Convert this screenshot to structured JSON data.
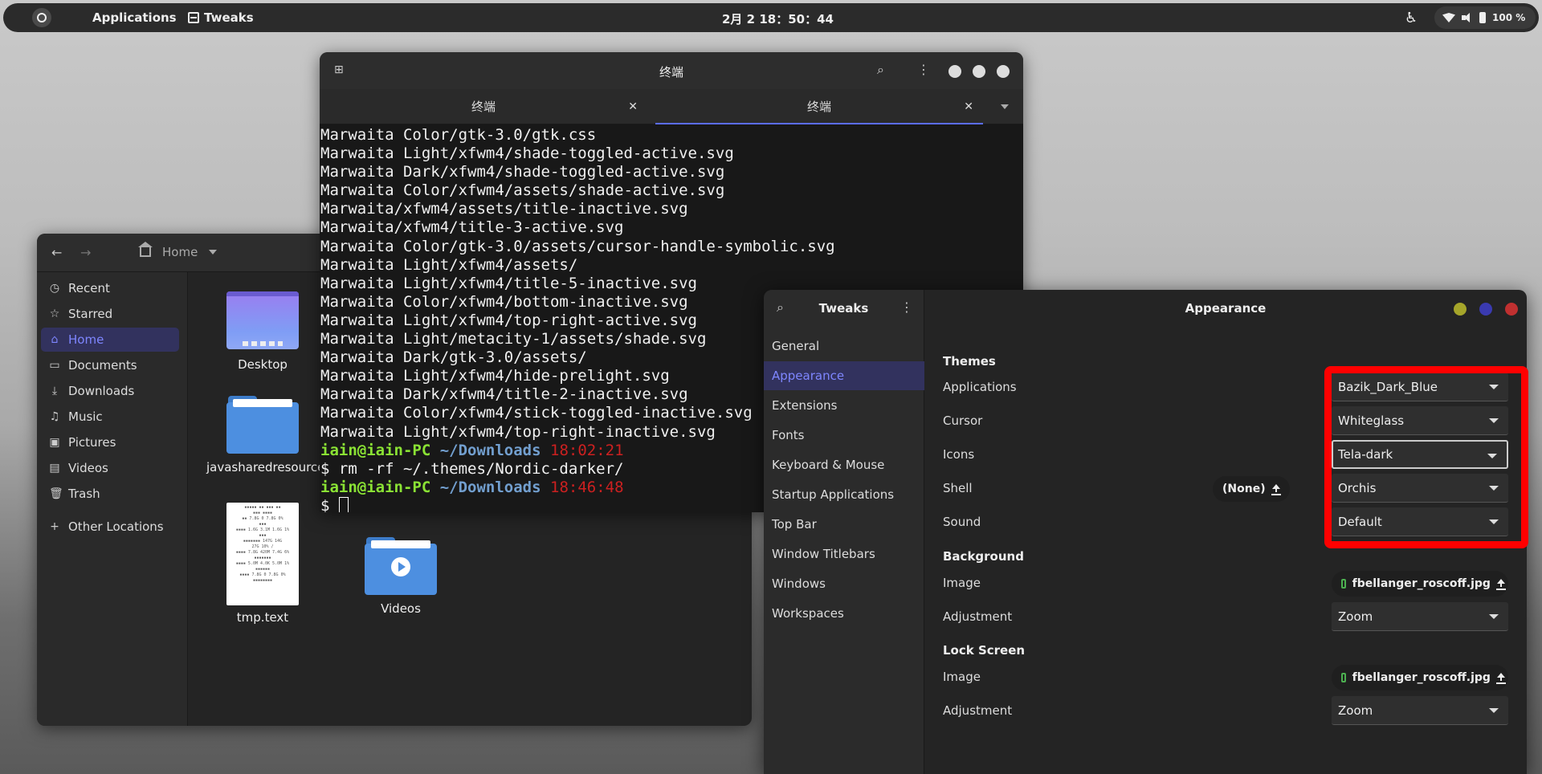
{
  "topbar": {
    "applications": "Applications",
    "active_app": "Tweaks",
    "clock": "2月 2  18：50：44",
    "battery": "100 %"
  },
  "files": {
    "path": "Home",
    "sidebar": [
      {
        "label": "Recent",
        "icon": "clock-icon"
      },
      {
        "label": "Starred",
        "icon": "star-icon"
      },
      {
        "label": "Home",
        "icon": "home-icon",
        "active": true
      },
      {
        "label": "Documents",
        "icon": "document-icon"
      },
      {
        "label": "Downloads",
        "icon": "download-icon"
      },
      {
        "label": "Music",
        "icon": "music-icon"
      },
      {
        "label": "Pictures",
        "icon": "picture-icon"
      },
      {
        "label": "Videos",
        "icon": "video-icon"
      },
      {
        "label": "Trash",
        "icon": "trash-icon"
      },
      {
        "label": "Other Locations",
        "icon": "plus-icon"
      }
    ],
    "items": [
      "Desktop",
      "javasharedresources",
      "tmp.text",
      "Videos"
    ]
  },
  "terminal": {
    "title": "终端",
    "tabs": [
      "终端",
      "终端"
    ],
    "lines": [
      "Marwaita Color/gtk-3.0/gtk.css",
      "Marwaita Light/xfwm4/shade-toggled-active.svg",
      "Marwaita Dark/xfwm4/shade-toggled-active.svg",
      "Marwaita Color/xfwm4/assets/shade-active.svg",
      "Marwaita/xfwm4/assets/title-inactive.svg",
      "Marwaita/xfwm4/title-3-active.svg",
      "Marwaita Color/gtk-3.0/assets/cursor-handle-symbolic.svg",
      "Marwaita Light/xfwm4/assets/",
      "Marwaita Light/xfwm4/title-5-inactive.svg",
      "Marwaita Color/xfwm4/bottom-inactive.svg",
      "Marwaita Light/xfwm4/top-right-active.svg",
      "Marwaita Light/metacity-1/assets/shade.svg",
      "Marwaita Dark/gtk-3.0/assets/",
      "Marwaita Light/xfwm4/hide-prelight.svg",
      "Marwaita Dark/xfwm4/title-2-inactive.svg",
      "Marwaita Color/xfwm4/stick-toggled-inactive.svg",
      "Marwaita Light/xfwm4/top-right-inactive.svg"
    ],
    "prompt1": {
      "user": "iain@iain-PC",
      "dir": "~/Downloads",
      "time": "18:02:21"
    },
    "command1": "$ rm -rf ~/.themes/Nordic-darker/",
    "prompt2": {
      "user": "iain@iain-PC",
      "dir": "~/Downloads",
      "time": "18:46:48"
    },
    "prompt_symbol": "$ "
  },
  "tweaks": {
    "title": "Tweaks",
    "page_title": "Appearance",
    "sidebar": [
      "General",
      "Appearance",
      "Extensions",
      "Fonts",
      "Keyboard & Mouse",
      "Startup Applications",
      "Top Bar",
      "Window Titlebars",
      "Windows",
      "Workspaces"
    ],
    "themes_header": "Themes",
    "applications_label": "Applications",
    "applications_value": "Bazik_Dark_Blue",
    "cursor_label": "Cursor",
    "cursor_value": "Whiteglass",
    "icons_label": "Icons",
    "icons_value": "Tela-dark",
    "shell_label": "Shell",
    "shell_value": "Orchis",
    "shell_none": "(None)",
    "sound_label": "Sound",
    "sound_value": "Default",
    "background_header": "Background",
    "bg_image_label": "Image",
    "bg_image_value": "fbellanger_roscoff.jpg",
    "bg_adjust_label": "Adjustment",
    "bg_adjust_value": "Zoom",
    "lock_header": "Lock Screen",
    "lock_image_label": "Image",
    "lock_image_value": "fbellanger_roscoff.jpg",
    "lock_adjust_label": "Adjustment",
    "lock_adjust_value": "Zoom"
  },
  "colors": {
    "accent": "#7e86ff",
    "highlight": "#ff0000",
    "prompt_user": "#8ae234",
    "prompt_dir": "#729fcf",
    "prompt_time": "#cc2020"
  }
}
